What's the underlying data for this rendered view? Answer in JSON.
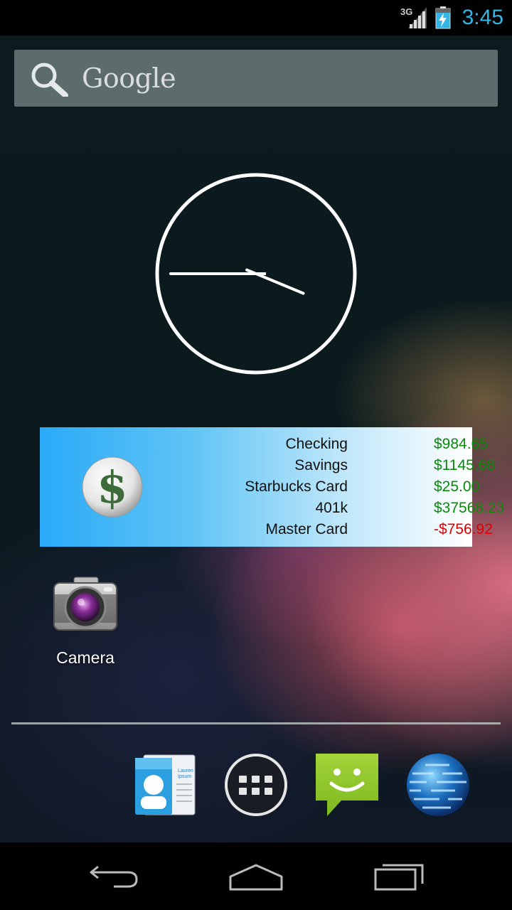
{
  "status_bar": {
    "network_label": "3G",
    "time": "3:45",
    "time_color": "#33b5e5",
    "icons": [
      "signal-icon",
      "battery-charging-icon"
    ]
  },
  "search_bar": {
    "label": "Google",
    "icon": "search-icon"
  },
  "clock_widget": {
    "type": "analog",
    "hour": 3,
    "minute": 45
  },
  "finance_widget": {
    "icon": "dollar-icon",
    "accounts": [
      {
        "label": "Checking",
        "amount": "$984.65",
        "negative": false
      },
      {
        "label": "Savings",
        "amount": "$1145.68",
        "negative": false
      },
      {
        "label": "Starbucks Card",
        "amount": "$25.00",
        "negative": false
      },
      {
        "label": "401k",
        "amount": "$37568.23",
        "negative": false
      },
      {
        "label": "Master Card",
        "amount": "-$756.92",
        "negative": true
      }
    ],
    "positive_color": "#0a8a0a",
    "negative_color": "#e00000"
  },
  "home_apps": [
    {
      "label": "Camera",
      "icon": "camera-icon"
    }
  ],
  "dock": [
    {
      "name": "contacts",
      "icon": "contacts-icon"
    },
    {
      "name": "all-apps",
      "icon": "app-drawer-icon"
    },
    {
      "name": "messaging",
      "icon": "messaging-icon"
    },
    {
      "name": "browser",
      "icon": "globe-icon"
    }
  ],
  "nav_bar": {
    "buttons": [
      "back-icon",
      "home-icon",
      "recent-apps-icon"
    ]
  }
}
